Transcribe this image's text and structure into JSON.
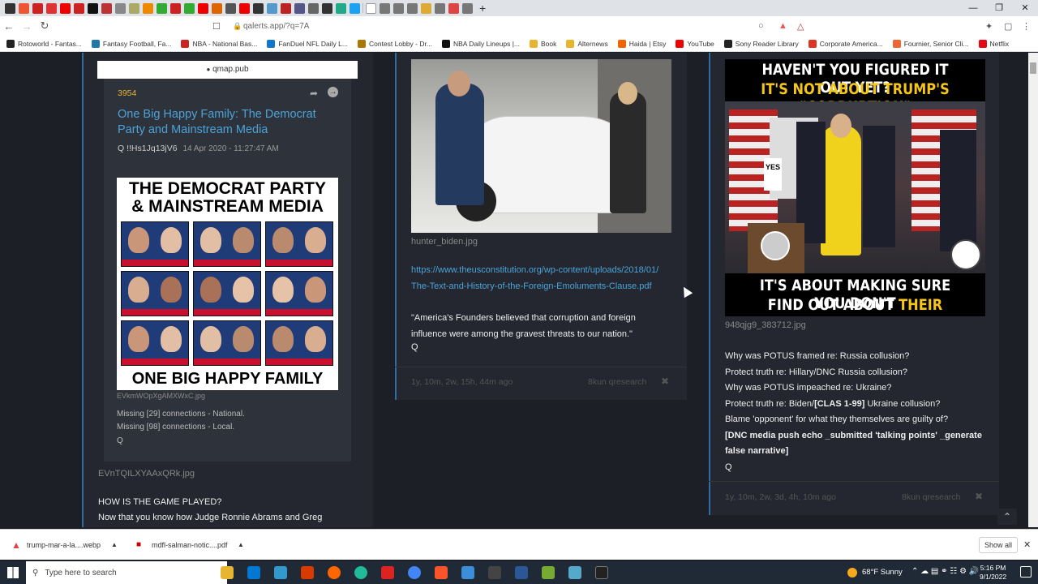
{
  "browser": {
    "url": "qalerts.app/?q=7A",
    "bookmarks": [
      "Rotoworld - Fantas...",
      "Fantasy Football, Fa...",
      "NBA - National Bas...",
      "FanDuel NFL Daily L...",
      "Contest Lobby - Dr...",
      "NBA Daily Lineups |...",
      "Book",
      "Alternews",
      "Haida | Etsy",
      "YouTube",
      "Sony Reader Library",
      "Corporate America...",
      "Fournier, Senior Cli...",
      "Netflix"
    ]
  },
  "col1": {
    "domain_bar": "qmap.pub",
    "post_number": "3954",
    "title": "One Big Happy Family: The Democrat Party and Mainstream Media",
    "author": "Q",
    "trip": "!!Hs1Jq13jV6",
    "date": "14 Apr 2020 - 11:27:47 AM",
    "image_title_1": "THE DEMOCRAT PARTY",
    "image_title_2": "& MAINSTREAM MEDIA",
    "image_bottom": "ONE BIG HAPPY FAMILY",
    "image_file": "EVkmWOpXgAMXWxC.jpg",
    "line1": "Missing [29] connections - National.",
    "line2": "Missing [98] connections - Local.",
    "sig": "Q",
    "file2": "EVnTQILXYAAxQRk.jpg",
    "heading": "HOW IS THE GAME PLAYED?",
    "para": "Now that you know how Judge Ronnie Abrams and Greg"
  },
  "col2": {
    "image_file": "hunter_biden.jpg",
    "link": "https://www.theusconstitution.org/wp-content/uploads/2018/01/The-Text-and-History-of-the-Foreign-Emoluments-Clause.pdf",
    "quote": "\"America's Founders believed that corruption and foreign influence were among the gravest threats to our nation.\"",
    "sig": "Q",
    "age": "1y, 10m, 2w, 15h, 44m ago",
    "source": "8kun qresearch"
  },
  "col3": {
    "meme_top1": "HAVEN'T YOU FIGURED IT OUT YET?",
    "meme_top2": "IT'S NOT ABOUT TRUMP'S \"CORRUPTION\"",
    "meme_bot1": "IT'S ABOUT MAKING SURE YOU DON'T",
    "meme_bot2a": "FIND OUT ABOUT ",
    "meme_bot2b": "THEIR CORRUPTION",
    "sign": "YES",
    "image_file": "948qjg9_383712.jpg",
    "lines": [
      "Why was POTUS framed re: Russia collusion?",
      "Protect truth re: Hillary/DNC Russia collusion?",
      "Why was POTUS impeached re: Ukraine?"
    ],
    "line4a": "Protect truth re: Biden/",
    "line4b": "[CLAS 1-99]",
    "line4c": " Ukraine collusion?",
    "line5": "Blame 'opponent' for what they themselves are guilty of?",
    "bold": "[DNC media push echo _submitted 'talking points' _generate false narrative]",
    "sig": "Q",
    "age": "1y, 10m, 2w, 3d, 4h, 10m ago",
    "source": "8kun qresearch"
  },
  "downloads": {
    "file1": "trump-mar-a-la....webp",
    "file2": "mdfl-salman-notic....pdf",
    "show_all": "Show all"
  },
  "taskbar": {
    "search_placeholder": "Type here to search",
    "weather": "68°F  Sunny",
    "time": "5:16 PM",
    "date": "9/1/2022"
  }
}
